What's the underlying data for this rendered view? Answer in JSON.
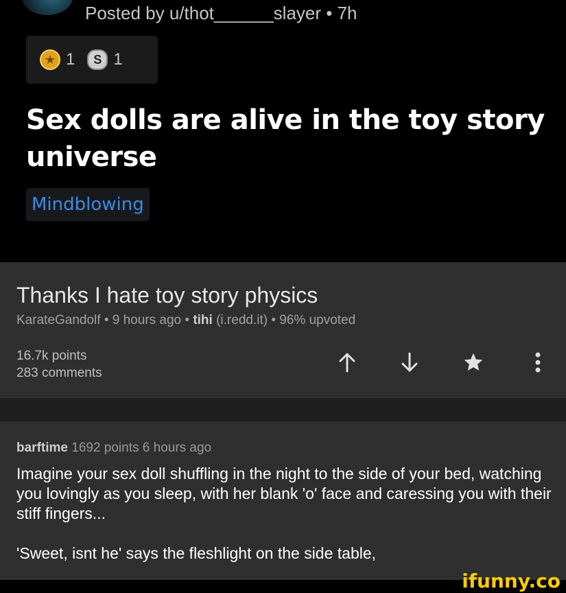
{
  "post": {
    "posted_by": "Posted by u/thot______slayer • 7h",
    "awards": [
      {
        "icon": "gold-award-icon",
        "count": "1"
      },
      {
        "icon": "silver-award-icon",
        "count": "1"
      }
    ],
    "title": "Sex dolls are alive in the toy story universe",
    "flair": "Mindblowing"
  },
  "card": {
    "title": "Thanks I hate toy story physics",
    "author": "KarateGandolf",
    "time": "9 hours ago",
    "subreddit": "tihi",
    "source": "(i.redd.it)",
    "upvoted": "96% upvoted",
    "points": "16.7k points",
    "comments": "283 comments",
    "actions": [
      "upvote-icon",
      "downvote-icon",
      "star-icon",
      "more-icon"
    ]
  },
  "comment": {
    "author": "barftime",
    "meta": "1692 points 6 hours ago",
    "paragraph1": "Imagine your sex doll shuffling in the night to the side of your bed, watching you lovingly as you sleep, with her blank 'o' face and caressing you with their stiff fingers...",
    "paragraph2": "'Sweet, isnt he' says the fleshlight on the side table,"
  },
  "watermark": "ifunny.co",
  "colors": {
    "flair": "#3d8be0",
    "card_bg": "#2f2f2f",
    "watermark": "#ffcc00"
  }
}
